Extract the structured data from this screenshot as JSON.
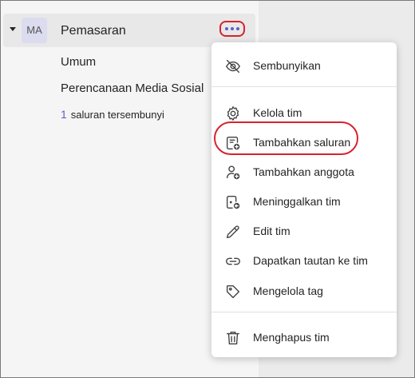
{
  "team": {
    "avatar": "MA",
    "name": "Pemasaran"
  },
  "channels": [
    {
      "name": "Umum"
    },
    {
      "name": "Perencanaan Media Sosial"
    }
  ],
  "hidden_channels": {
    "count": "1",
    "label": "saluran tersembunyi"
  },
  "menu": {
    "items": [
      {
        "label": "Sembunyikan",
        "icon": "eye-off-icon"
      },
      {
        "label": "Kelola tim",
        "icon": "gear-icon"
      },
      {
        "label": "Tambahkan saluran",
        "icon": "add-channel-icon"
      },
      {
        "label": "Tambahkan anggota",
        "icon": "add-member-icon"
      },
      {
        "label": "Meninggalkan tim",
        "icon": "leave-team-icon"
      },
      {
        "label": "Edit tim",
        "icon": "pencil-icon"
      },
      {
        "label": "Dapatkan tautan ke tim",
        "icon": "link-icon"
      },
      {
        "label": "Mengelola tag",
        "icon": "tag-icon"
      },
      {
        "label": "Menghapus tim",
        "icon": "trash-icon"
      }
    ]
  },
  "colors": {
    "accent": "#5b5fc7",
    "highlight": "#d6232f"
  }
}
